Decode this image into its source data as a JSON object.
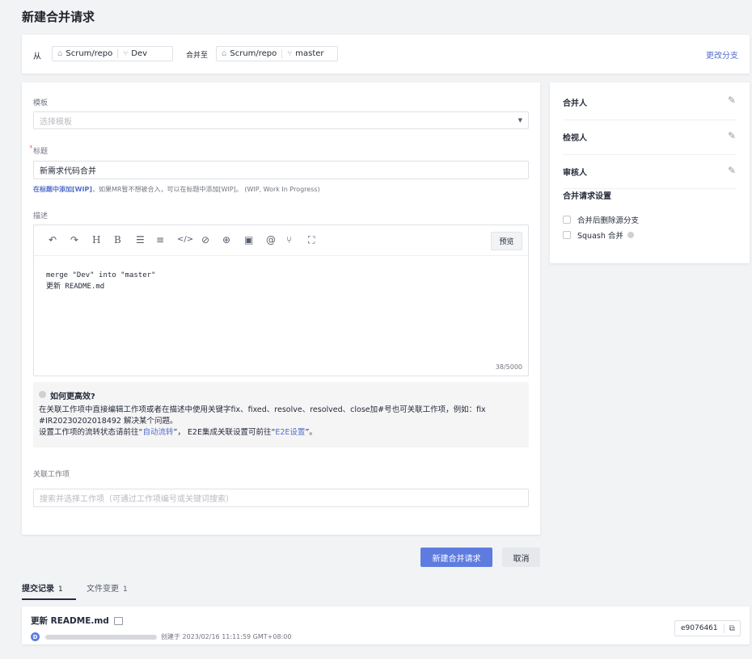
{
  "page": {
    "title": "新建合并请求"
  },
  "branch": {
    "from_label": "从",
    "source_repo": "Scrum/repo",
    "source_branch": "Dev",
    "to_label": "合并至",
    "target_repo": "Scrum/repo",
    "target_branch": "master",
    "change_branch": "更改分支"
  },
  "form": {
    "template_label": "模板",
    "template_placeholder": "选择模板",
    "title_required": "*",
    "title_label": "标题",
    "title_value": "新需求代码合并",
    "wip_link": "在标题中添加[WIP]",
    "wip_text": "，如果MR暂不想被合入，可以在标题中添加[WIP]。 (WIP, Work In Progress)",
    "desc_label": "描述",
    "preview": "预览",
    "desc_line1": "merge \"Dev\" into \"master\"",
    "desc_line2": "更新 README.md",
    "char_count": "38/5000",
    "tip_title": "如何更高效?",
    "tip_line1": "在关联工作项中直接编辑工作项或者在描述中使用关键字fix、fixed、resolve、resolved、close加#号也可关联工作项，例如：fix",
    "tip_line2": "#IR20230202018492 解决某个问题。",
    "tip_line3_a": "设置工作项的流转状态请前往“",
    "tip_link1": "自动流转",
    "tip_line3_b": "”， E2E集成关联设置可前往“",
    "tip_link2": "E2E设置",
    "tip_line3_c": "”。",
    "work_label": "关联工作项",
    "work_placeholder": "搜索并选择工作项（可通过工作项编号或关键词搜索）"
  },
  "side": {
    "merger": "合并人",
    "reviewer": "检视人",
    "approver": "审核人",
    "settings": "合并请求设置",
    "opt_delete": "合并后删除源分支",
    "opt_squash": "Squash 合并"
  },
  "actions": {
    "create": "新建合并请求",
    "cancel": "取消"
  },
  "tabs": {
    "commits": "提交记录",
    "commits_count": "1",
    "files": "文件变更",
    "files_count": "1"
  },
  "commit": {
    "title": "更新 README.md",
    "avatar": "D",
    "created": "创建于 2023/02/16 11:11:59 GMT+08:00",
    "hash": "e9076461"
  },
  "colors": {
    "primary": "#5e7ce0",
    "link": "#526ecc"
  }
}
